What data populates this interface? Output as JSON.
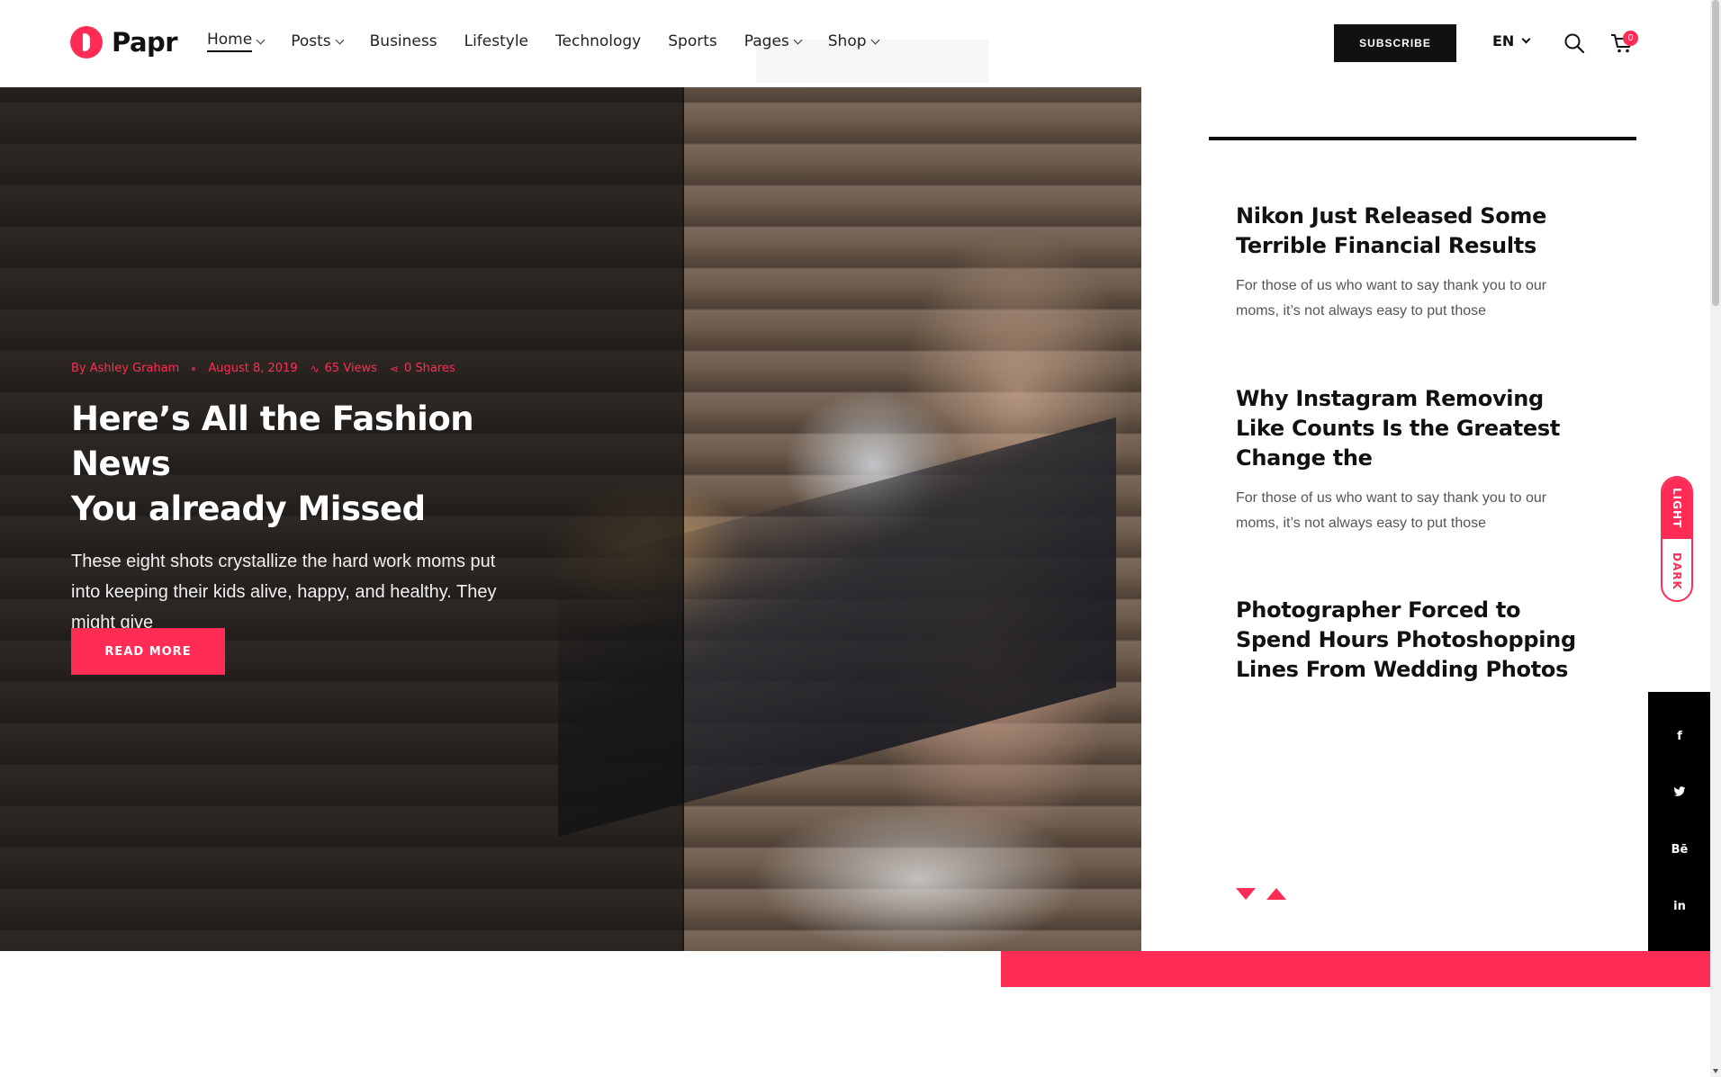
{
  "brand": {
    "name": "Papr"
  },
  "nav": {
    "items": [
      {
        "label": "Home",
        "has_dropdown": true,
        "active": true
      },
      {
        "label": "Posts",
        "has_dropdown": true
      },
      {
        "label": "Business",
        "has_dropdown": false
      },
      {
        "label": "Lifestyle",
        "has_dropdown": false
      },
      {
        "label": "Technology",
        "has_dropdown": false
      },
      {
        "label": "Sports",
        "has_dropdown": false
      },
      {
        "label": "Pages",
        "has_dropdown": true
      },
      {
        "label": "Shop",
        "has_dropdown": true
      }
    ],
    "subscribe_label": "SUBSCRIBE",
    "language": "EN",
    "cart_count": "0"
  },
  "hero": {
    "author": "By Ashley Graham",
    "date": "August 8, 2019",
    "views": "65 Views",
    "shares": "0 Shares",
    "title_line1": "Here’s All the Fashion News",
    "title_line2": "You already Missed",
    "description": "These eight shots crystallize the hard work moms put into keeping their kids alive, happy, and healthy. They might give",
    "cta_label": "READ MORE"
  },
  "sidebar": {
    "posts": [
      {
        "title": "Nikon Just Released Some Terrible Financial Results",
        "excerpt": "For those of us who want to say thank you to our moms, it’s not always easy to put those"
      },
      {
        "title": "Why Instagram Removing Like Counts Is the Greatest Change the",
        "excerpt": "For those of us who want to say thank you to our moms, it’s not always easy to put those"
      },
      {
        "title": "Photographer Forced to Spend Hours Photoshopping Lines From Wedding Photos",
        "excerpt": ""
      }
    ]
  },
  "theme_toggle": {
    "light_label": "LIGHT",
    "dark_label": "DARK"
  },
  "social": [
    {
      "name": "facebook-icon",
      "glyph": "f"
    },
    {
      "name": "twitter-icon",
      "glyph": "🐦"
    },
    {
      "name": "behance-icon",
      "glyph": "Bē"
    },
    {
      "name": "linkedin-icon",
      "glyph": "in"
    }
  ],
  "colors": {
    "accent": "#ff2d55",
    "dark": "#111111"
  }
}
